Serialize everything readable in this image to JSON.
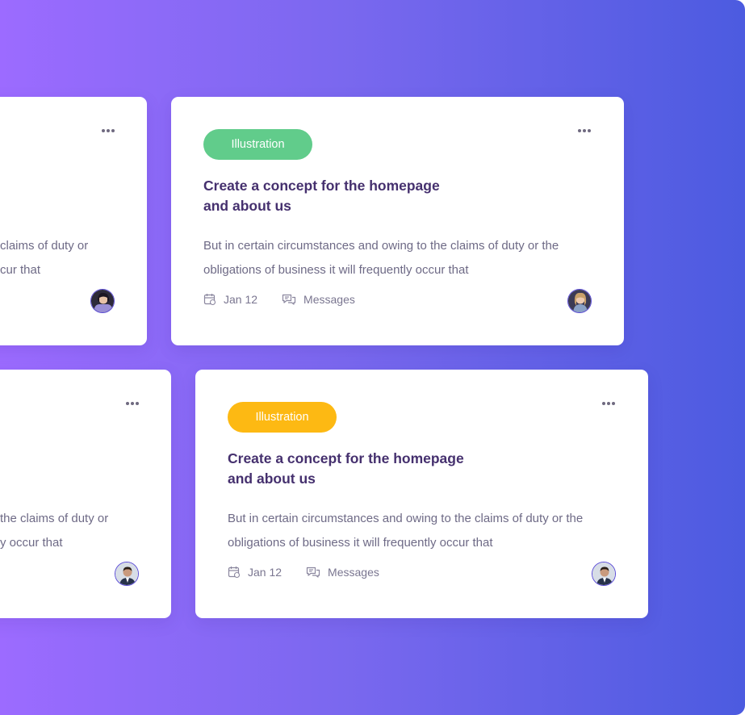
{
  "background": {
    "from": "#9c6bff",
    "to": "#4c5be0"
  },
  "cards": [
    {
      "tag": {
        "label": "",
        "color": "#61cc8b"
      },
      "title": "",
      "description": "claims of duty or\ncur that",
      "date": "",
      "messages": ""
    },
    {
      "tag": {
        "label": "Illustration",
        "color": "#61cc8b"
      },
      "title": "Create a concept for the homepage\nand about us",
      "description": "But in certain circumstances and owing to the claims of duty or the obligations of business it will frequently occur that",
      "date": "Jan 12",
      "messages": "Messages",
      "avatar": "avatar-woman-blonde",
      "more_icon": "more-horizontal-icon"
    },
    {
      "tag": {
        "label": "",
        "color": "#fdb913"
      },
      "title": "e",
      "description": "the claims of duty or\ny occur that",
      "date": "",
      "messages": ""
    },
    {
      "tag": {
        "label": "Illustration",
        "color": "#fdb913"
      },
      "title": "Create a concept for the homepage\nand about us",
      "description": "But in certain circumstances and owing to the claims of duty or the obligations of business it will frequently occur that",
      "date": "Jan 12",
      "messages": "Messages",
      "avatar": "avatar-man-suit",
      "more_icon": "more-horizontal-icon"
    }
  ]
}
